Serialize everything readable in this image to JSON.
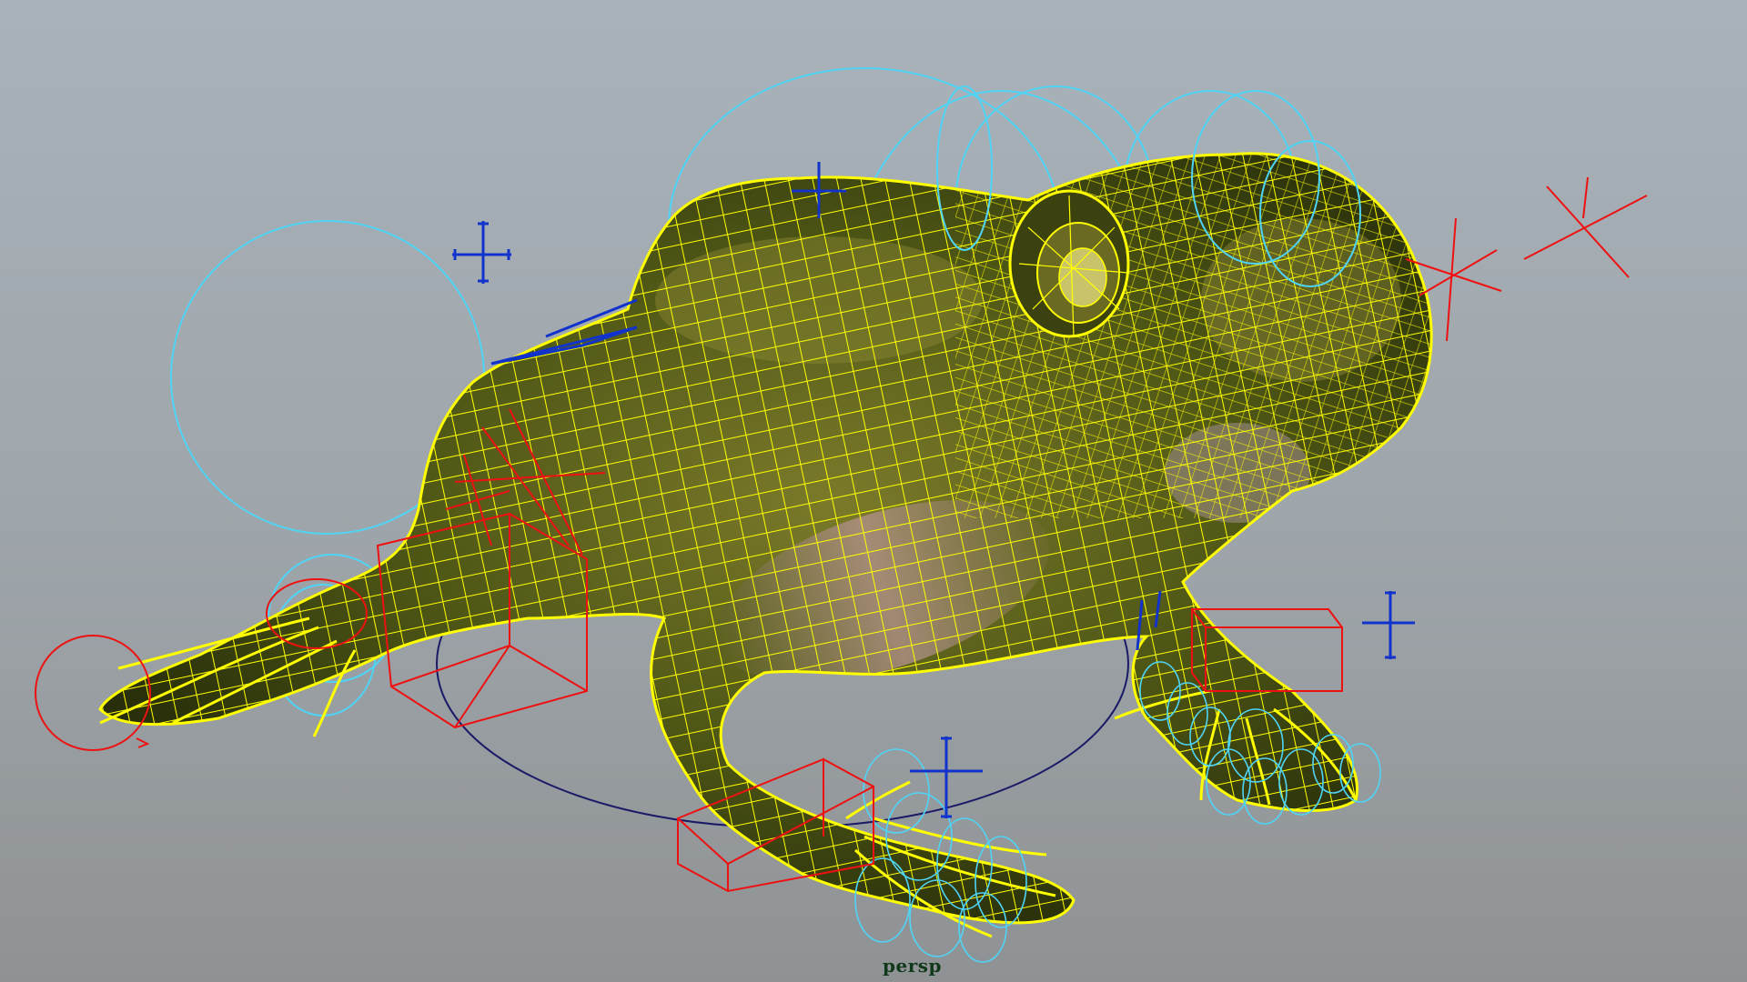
{
  "viewport": {
    "camera_label": "persp",
    "background_top": "#a9b2ba",
    "background_bottom": "#8f9294"
  },
  "model": {
    "subject": "frog",
    "wireframe_color": "#ffff00",
    "skin_colors": [
      "#4a5214",
      "#7a7a26",
      "#2c3309",
      "#b0848a"
    ]
  },
  "rig_colors": {
    "circle_controls": "#4fd4f5",
    "ik_handles": "#1133cc",
    "locators": "#ee1111",
    "root_control": "#1a1a66"
  }
}
